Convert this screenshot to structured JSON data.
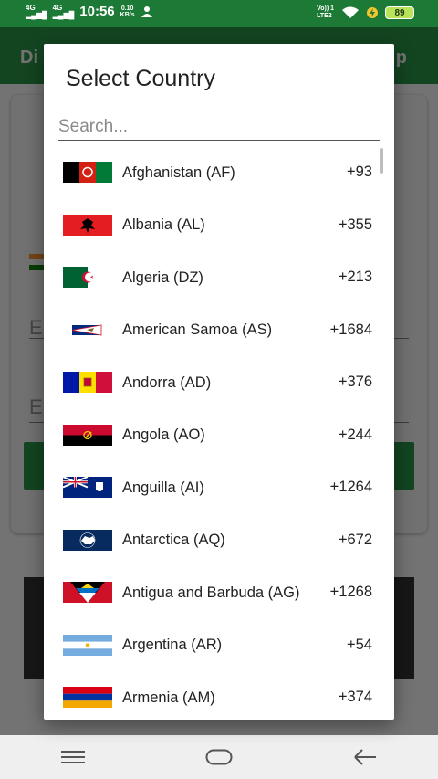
{
  "status_bar": {
    "signal1": "4G",
    "signal2": "4G",
    "time": "10:56",
    "speed_value": "0.10",
    "speed_unit": "KB/s",
    "volte_top": "Vo)) 1",
    "volte_bottom": "LTE2",
    "battery": "89"
  },
  "background": {
    "app_title_left": "Di",
    "app_title_right": "p",
    "field_hint_1": "E",
    "field_hint_2": "E"
  },
  "dialog": {
    "title": "Select Country",
    "search_placeholder": "Search...",
    "countries": [
      {
        "name": "Afghanistan (AF)",
        "code": "+93",
        "flag": "afghanistan-flag"
      },
      {
        "name": "Albania (AL)",
        "code": "+355",
        "flag": "albania-flag"
      },
      {
        "name": "Algeria (DZ)",
        "code": "+213",
        "flag": "algeria-flag"
      },
      {
        "name": "American Samoa (AS)",
        "code": "+1684",
        "flag": "american-samoa-flag"
      },
      {
        "name": "Andorra (AD)",
        "code": "+376",
        "flag": "andorra-flag"
      },
      {
        "name": "Angola (AO)",
        "code": "+244",
        "flag": "angola-flag"
      },
      {
        "name": "Anguilla (AI)",
        "code": "+1264",
        "flag": "anguilla-flag"
      },
      {
        "name": "Antarctica (AQ)",
        "code": "+672",
        "flag": "antarctica-flag"
      },
      {
        "name": "Antigua and Barbuda (AG)",
        "code": "+1268",
        "flag": "antigua-barbuda-flag"
      },
      {
        "name": "Argentina (AR)",
        "code": "+54",
        "flag": "argentina-flag"
      },
      {
        "name": "Armenia (AM)",
        "code": "+374",
        "flag": "armenia-flag"
      }
    ]
  },
  "nav_bar": {
    "icons": [
      "menu-icon",
      "home-icon",
      "back-icon"
    ]
  },
  "colors": {
    "app_green": "#2a9a4a",
    "status_green": "#1c7a36",
    "battery": "#b9e45a"
  }
}
